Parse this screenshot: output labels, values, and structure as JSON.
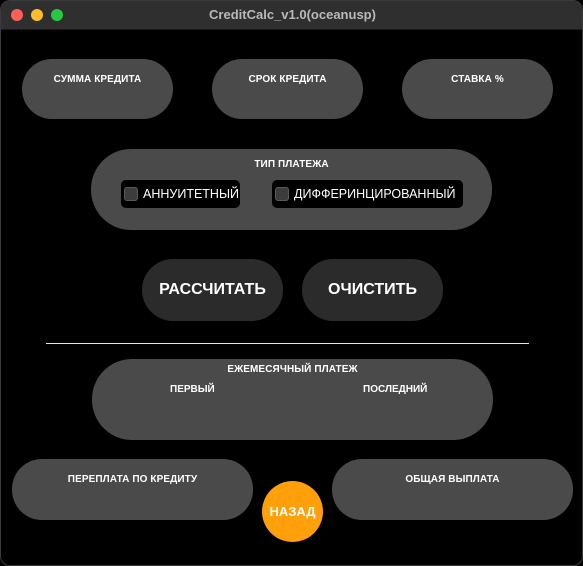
{
  "window": {
    "title": "CreditCalc_v1.0(oceanusp)"
  },
  "inputs": {
    "amount_label": "СУММА КРЕДИТА",
    "term_label": "СРОК КРЕДИТА",
    "rate_label": "СТАВКА %"
  },
  "payment_type": {
    "label": "ТИП ПЛАТЕЖА",
    "options": [
      {
        "label": "АННУИТЕТНЫЙ",
        "checked": false
      },
      {
        "label": "ДИФФЕРИНЦИРОВАННЫЙ",
        "checked": false
      }
    ]
  },
  "actions": {
    "calculate_label": "РАССЧИТАТЬ",
    "clear_label": "ОЧИСТИТЬ"
  },
  "results": {
    "monthly_label": "ЕЖЕМЕСЯЧНЫЙ ПЛАТЕЖ",
    "first_label": "ПЕРВЫЙ",
    "last_label": "ПОСЛЕДНИЙ",
    "overpayment_label": "ПЕРЕПЛАТА ПО КРЕДИТУ",
    "total_label": "ОБЩАЯ ВЫПЛАТА"
  },
  "navigation": {
    "back_label": "НАЗАД"
  },
  "colors": {
    "background": "#000000",
    "pill": "#4a4a4a",
    "button": "#2b2b2b",
    "accent": "#ff9f0a"
  }
}
